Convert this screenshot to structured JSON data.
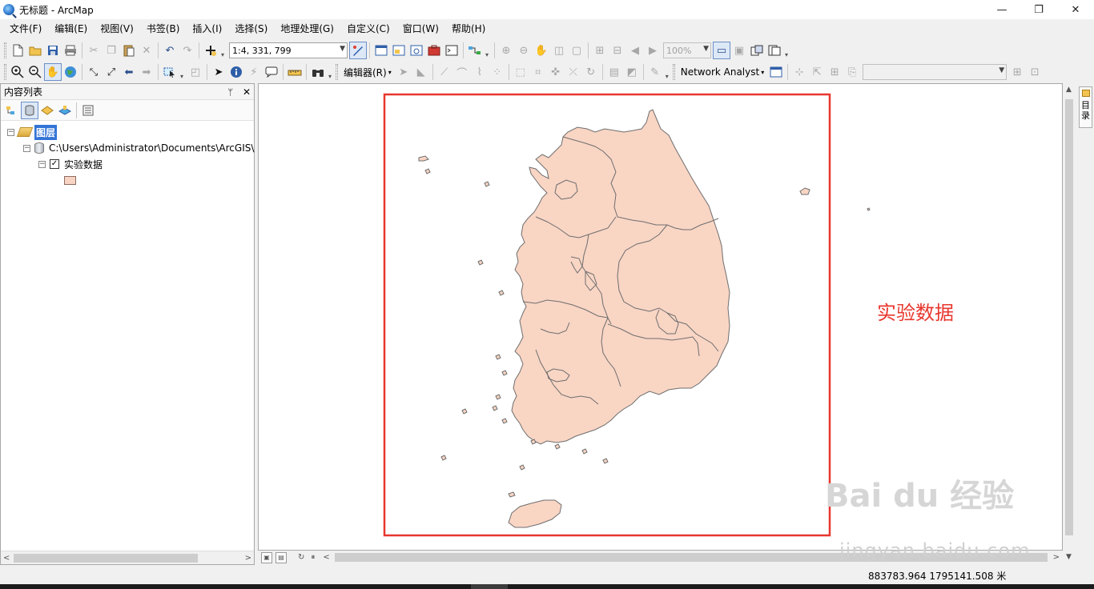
{
  "window": {
    "title": "无标题 - ArcMap",
    "min": "—",
    "max": "❐",
    "close": "✕"
  },
  "menu": [
    "文件(F)",
    "编辑(E)",
    "视图(V)",
    "书签(B)",
    "插入(I)",
    "选择(S)",
    "地理处理(G)",
    "自定义(C)",
    "窗口(W)",
    "帮助(H)"
  ],
  "toolbar": {
    "scale_value": "1:4, 331, 799",
    "zoom_value": "100%",
    "editor_label": "编辑器(R)",
    "network_analyst_label": "Network Analyst"
  },
  "toc": {
    "title": "内容列表",
    "pin": "ᛘ",
    "close": "✕",
    "root_layer": "图层",
    "workspace_path": "C:\\Users\\Administrator\\Documents\\ArcGIS\\",
    "layer_name": "实验数据",
    "layer_checked": "✓",
    "layer_fill_color": "#f8d4c4"
  },
  "right_dock": {
    "tab_label": "目录"
  },
  "map": {
    "annotation": "实验数据",
    "frame_color": "#e8372e",
    "fill_color": "#f9d5c4"
  },
  "status": {
    "coordinates": "883783.964  1795141.508 米"
  },
  "watermark": {
    "logo_text": "Bai du 经验",
    "url": "jingyan.baidu.com"
  }
}
